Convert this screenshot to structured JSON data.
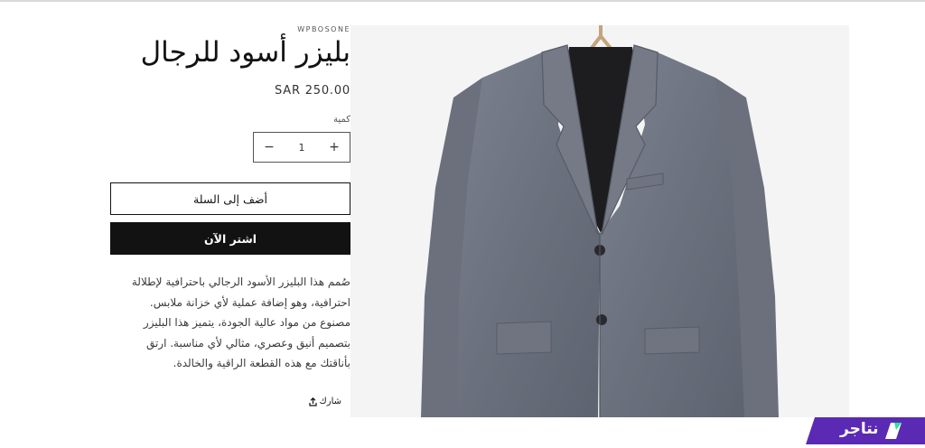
{
  "product": {
    "vendor": "WPBOSONE",
    "title": "بليزر أسود للرجال",
    "price": "SAR 250.00",
    "quantity_label": "كمية",
    "quantity_value": "1",
    "increase_symbol": "+",
    "decrease_symbol": "−",
    "add_to_cart_label": "أضف إلى السلة",
    "buy_now_label": "اشتر الآن",
    "description_lines": [
      "صُمم هذا البليزر الأسود الرجالي باحترافية لإطلالة",
      "احترافية، وهو إضافة عملية لأي خزانة ملابس.",
      "مصنوع من مواد عالية الجودة، يتميز هذا البليزر",
      "بتصميم أنيق وعصري، مثالي لأي مناسبة. ارتق",
      "بأناقتك مع هذه القطعة الراقية والخالدة."
    ],
    "share_label": "شارك",
    "share_icon": "share-icon"
  },
  "media": {
    "image": "gray-blazer-on-hanger"
  },
  "brand": {
    "label": "نتاجر",
    "color": "#5b2ab5"
  },
  "colors": {
    "primary": "#121212",
    "text": "#3a3a3a",
    "background": "#ffffff"
  }
}
